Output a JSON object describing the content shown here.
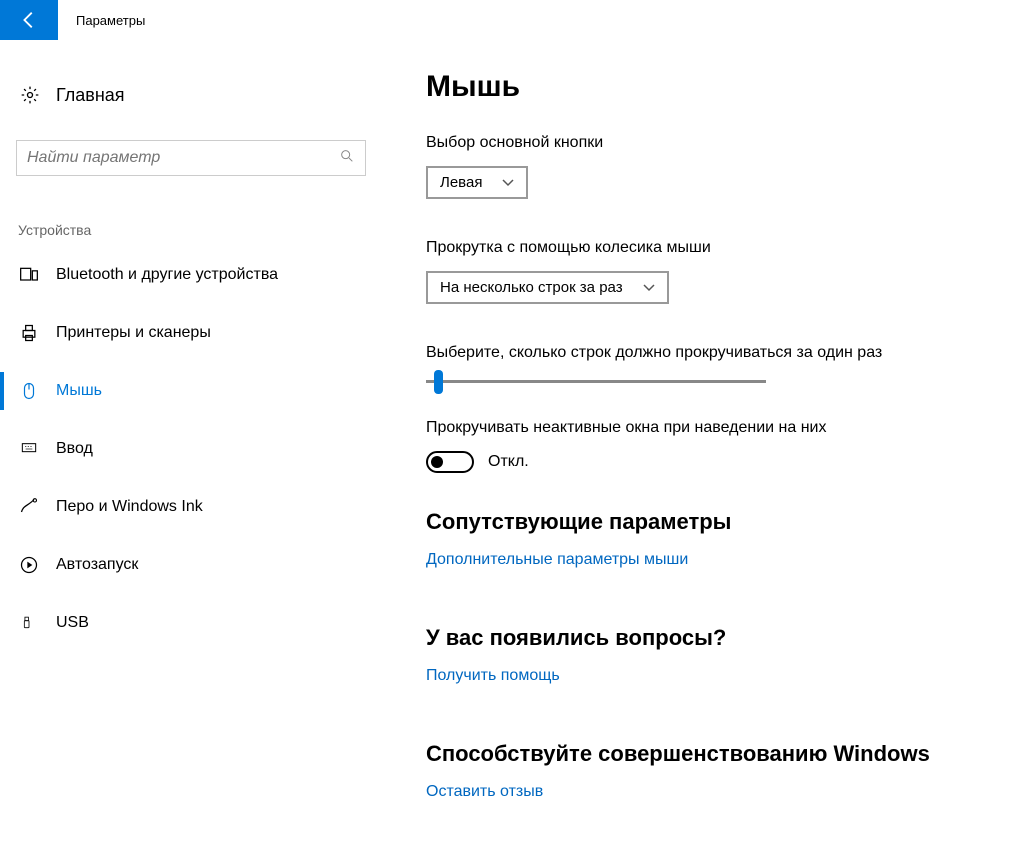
{
  "header": {
    "title": "Параметры"
  },
  "sidebar": {
    "home": "Главная",
    "search_placeholder": "Найти параметр",
    "group": "Устройства",
    "items": [
      {
        "label": "Bluetooth и другие устройства"
      },
      {
        "label": "Принтеры и сканеры"
      },
      {
        "label": "Мышь"
      },
      {
        "label": "Ввод"
      },
      {
        "label": "Перо и Windows Ink"
      },
      {
        "label": "Автозапуск"
      },
      {
        "label": "USB"
      }
    ]
  },
  "main": {
    "title": "Мышь",
    "primary_button": {
      "label": "Выбор основной кнопки",
      "value": "Левая"
    },
    "scroll_wheel": {
      "label": "Прокрутка с помощью колесика мыши",
      "value": "На несколько строк за раз"
    },
    "lines_label": "Выберите, сколько строк должно прокручиваться за один раз",
    "inactive": {
      "label": "Прокручивать неактивные окна при наведении на них",
      "state": "Откл."
    },
    "related": {
      "title": "Сопутствующие параметры",
      "link": "Дополнительные параметры мыши"
    },
    "help": {
      "title": "У вас появились вопросы?",
      "link": "Получить помощь"
    },
    "feedback": {
      "title": "Способствуйте совершенствованию Windows",
      "link": "Оставить отзыв"
    }
  }
}
